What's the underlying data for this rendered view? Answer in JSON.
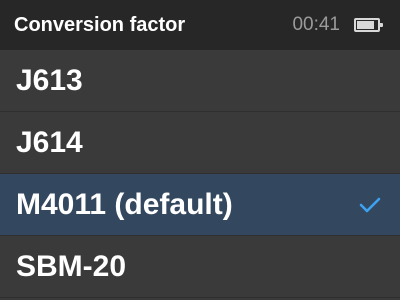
{
  "header": {
    "title": "Conversion factor",
    "clock": "00:41",
    "battery_level": 0.85
  },
  "items": [
    {
      "label": "J613",
      "selected": false
    },
    {
      "label": "J614",
      "selected": false
    },
    {
      "label": "M4011 (default)",
      "selected": true
    },
    {
      "label": "SBM-20",
      "selected": false
    }
  ],
  "colors": {
    "header_bg": "#272727",
    "list_bg": "#3a3a3a",
    "selected_bg": "#33475e",
    "check": "#3da2f2"
  },
  "icons": {
    "check": "check-icon",
    "battery": "battery-icon"
  }
}
